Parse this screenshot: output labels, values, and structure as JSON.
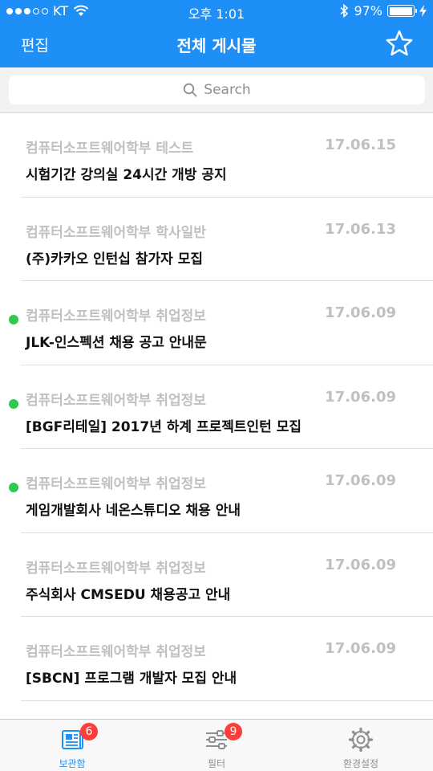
{
  "status_bar": {
    "carrier": "KT",
    "time": "오후 1:01",
    "battery_percent": "97%",
    "battery_level": 0.97,
    "signal_bars": 3,
    "signal_max": 5
  },
  "nav": {
    "left_label": "편집",
    "title": "전체 게시물",
    "right_icon": "star-icon"
  },
  "search": {
    "placeholder": "Search"
  },
  "posts": [
    {
      "category": "컴퓨터소프트웨어학부 테스트",
      "date": "17.06.15",
      "title": "시험기간 강의실 24시간 개방 공지",
      "unread": false
    },
    {
      "category": "컴퓨터소프트웨어학부 학사일반",
      "date": "17.06.13",
      "title": "(주)카카오 인턴십 참가자 모집",
      "unread": false
    },
    {
      "category": "컴퓨터소프트웨어학부 취업정보",
      "date": "17.06.09",
      "title": "JLK-인스펙션 채용 공고 안내문",
      "unread": true
    },
    {
      "category": "컴퓨터소프트웨어학부 취업정보",
      "date": "17.06.09",
      "title": "[BGF리테일] 2017년 하계 프로젝트인턴 모집",
      "unread": true
    },
    {
      "category": "컴퓨터소프트웨어학부 취업정보",
      "date": "17.06.09",
      "title": "게임개발회사 네온스튜디오 채용 안내",
      "unread": true
    },
    {
      "category": "컴퓨터소프트웨어학부 취업정보",
      "date": "17.06.09",
      "title": "주식회사 CMSEDU 채용공고 안내",
      "unread": false
    },
    {
      "category": "컴퓨터소프트웨어학부 취업정보",
      "date": "17.06.09",
      "title": "[SBCN] 프로그램 개발자 모집 안내",
      "unread": false
    }
  ],
  "tabbar": {
    "tabs": [
      {
        "label": "보관함",
        "icon": "newspaper-icon",
        "badge": "6",
        "active": true
      },
      {
        "label": "필터",
        "icon": "sliders-icon",
        "badge": "9",
        "active": false
      },
      {
        "label": "환경설정",
        "icon": "gear-icon",
        "badge": "",
        "active": false
      }
    ]
  },
  "colors": {
    "accent": "#1e8ff7",
    "unread_dot": "#2ec94f",
    "badge": "#fc3d39",
    "muted_text": "#c0c0c4"
  }
}
